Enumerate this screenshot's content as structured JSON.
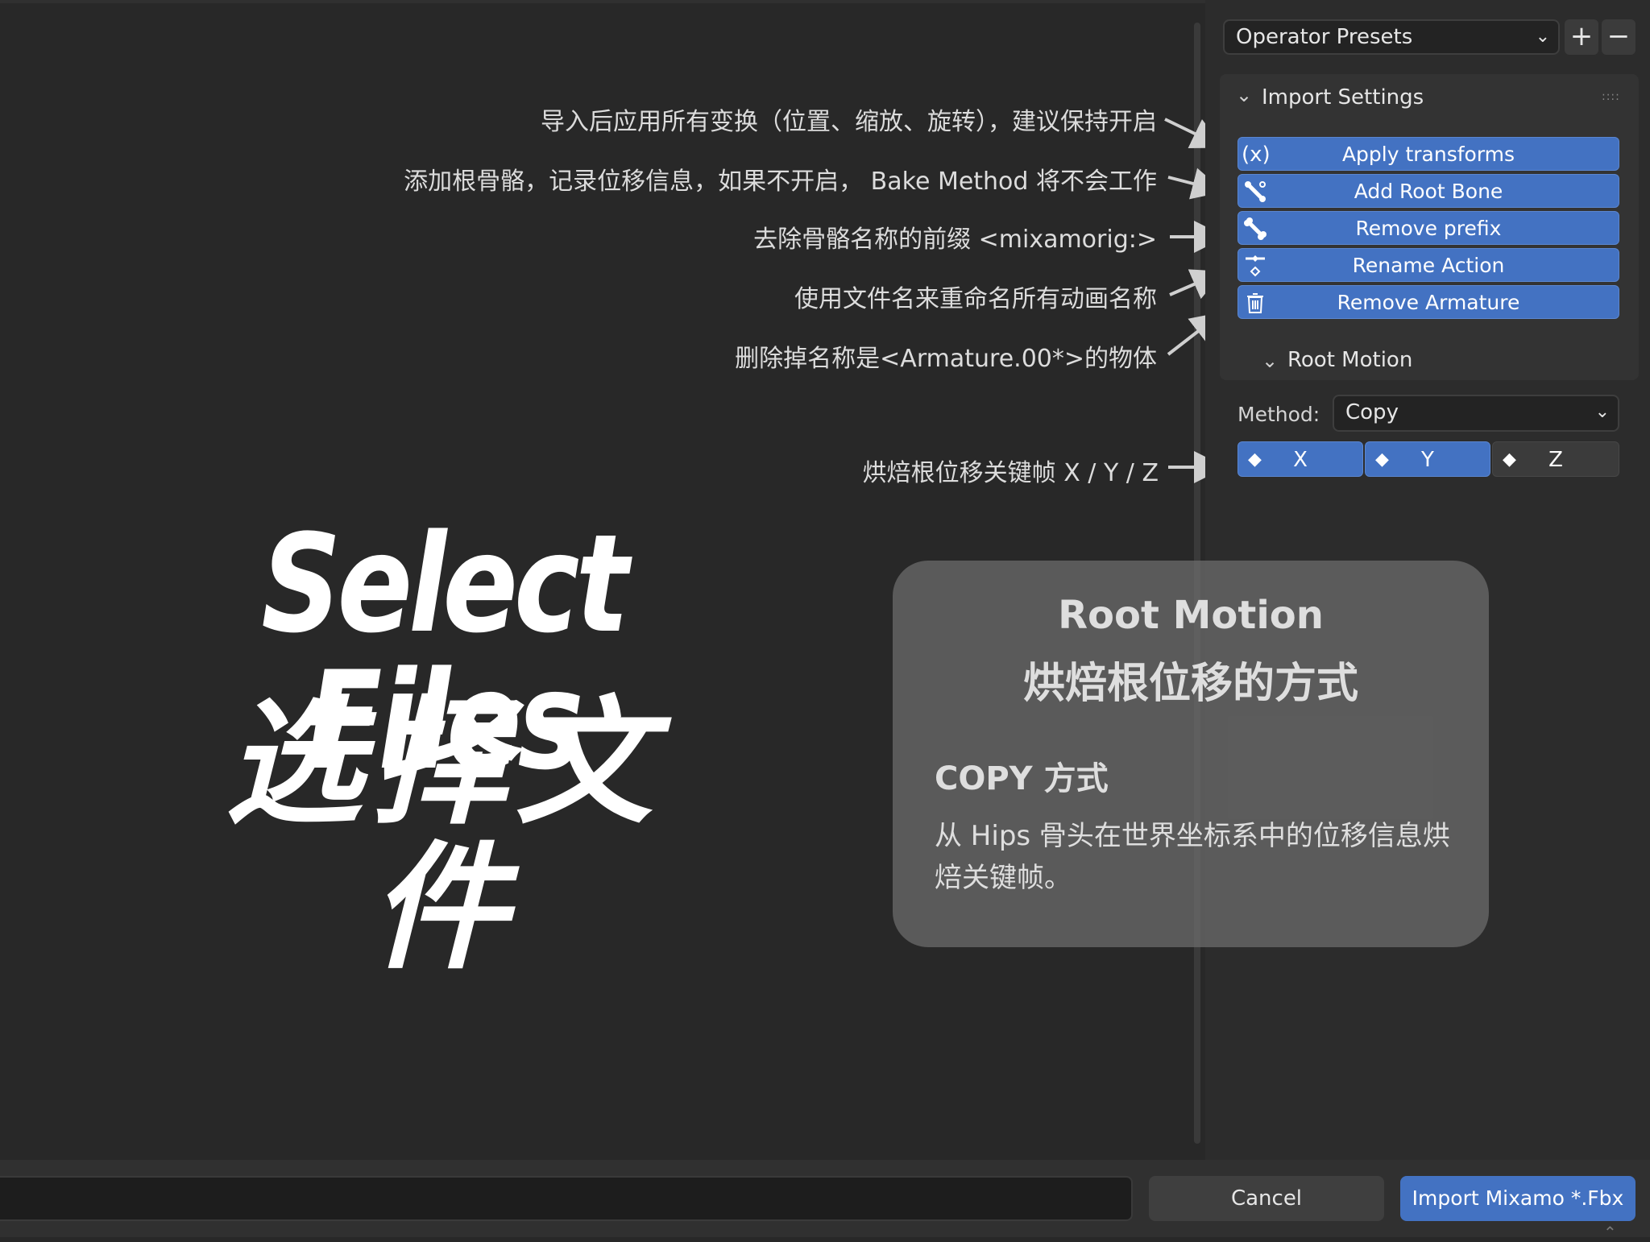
{
  "annotations": [
    "导入后应用所有变换（位置、缩放、旋转），建议保持开启",
    "添加根骨骼，记录位移信息，如果不开启， Bake Method 将不会工作",
    "去除骨骼名称的前缀 <mixamorig:>",
    "使用文件名来重命名所有动画名称",
    "删除掉名称是<Armature.00*>的物体",
    "烘焙根位移关键帧 X / Y / Z"
  ],
  "overlay": {
    "title": "Select Files",
    "subtitle": "选择文件"
  },
  "tooltip": {
    "title": "Root Motion",
    "subtitle": "烘焙根位移的方式",
    "heading": "COPY 方式",
    "body": "从 Hips 骨头在世界坐标系中的位移信息烘焙关键帧。"
  },
  "panel": {
    "presets_label": "Operator Presets",
    "add_label": "+",
    "remove_label": "−",
    "import_settings": "Import Settings",
    "buttons": [
      {
        "label": "Apply transforms",
        "icon": "variable-x-icon"
      },
      {
        "label": "Add Root Bone",
        "icon": "bone-add-icon"
      },
      {
        "label": "Remove prefix",
        "icon": "bone-icon"
      },
      {
        "label": "Rename Action",
        "icon": "action-keyframe-icon"
      },
      {
        "label": "Remove Armature",
        "icon": "trash-icon"
      }
    ],
    "root_motion": "Root Motion",
    "method_label": "Method:",
    "method_value": "Copy",
    "axes": [
      {
        "label": "X",
        "on": true
      },
      {
        "label": "Y",
        "on": true
      },
      {
        "label": "Z",
        "on": false
      }
    ]
  },
  "footer": {
    "filename": "",
    "cancel": "Cancel",
    "import": "Import Mixamo *.Fbx"
  },
  "colors": {
    "accent": "#4372c2",
    "background": "#282828",
    "panel": "#2c2c2c"
  }
}
